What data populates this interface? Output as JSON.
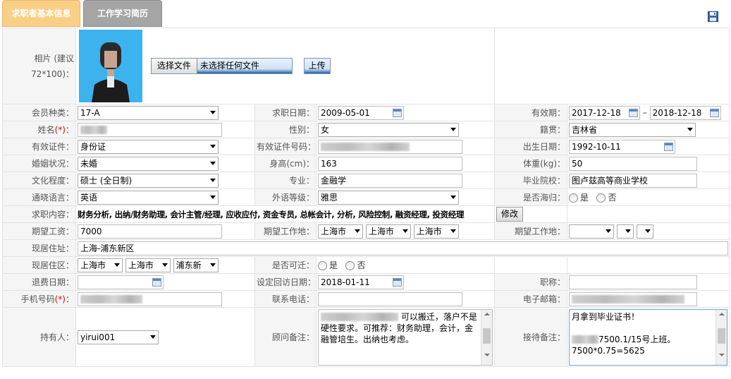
{
  "tabs": [
    {
      "label": "求职者基本信息",
      "active": true
    },
    {
      "label": "工作学习简历",
      "active": false
    }
  ],
  "photo": {
    "label": "相片 (建议72*100)：",
    "choose_file": "选择文件",
    "no_file": "未选择任何文件",
    "upload": "上传"
  },
  "fields": {
    "member_type": {
      "label": "会员种类：",
      "value": "17-A"
    },
    "apply_date": {
      "label": "求职日期：",
      "value": "2009-05-01"
    },
    "valid_period": {
      "label": "有效期：",
      "from": "2017-12-18",
      "sep": "–",
      "to": "2018-12-18"
    },
    "name": {
      "label": "姓名",
      "required_mark": "(*)",
      "colon": "："
    },
    "gender": {
      "label": "性别：",
      "value": "女"
    },
    "native_place": {
      "label": "籍贯：",
      "value": "吉林省"
    },
    "id_type": {
      "label": "有效证件：",
      "value": "身份证"
    },
    "id_number": {
      "label": "有效证件号码："
    },
    "birth_date": {
      "label": "出生日期：",
      "value": "1992-10-11"
    },
    "marital": {
      "label": "婚姻状况：",
      "value": "未婚"
    },
    "height": {
      "label": "身高(cm)：",
      "value": "163"
    },
    "weight": {
      "label": "体重(kg)：",
      "value": "50"
    },
    "education": {
      "label": "文化程度：",
      "value": "硕士 (全日制)"
    },
    "major": {
      "label": "专业：",
      "value": "金融学"
    },
    "school": {
      "label": "毕业院校：",
      "value": "图卢兹高等商业学校"
    },
    "language": {
      "label": "通晓语言：",
      "value": "英语"
    },
    "foreign_level": {
      "label": "外语等级：",
      "value": "雅思"
    },
    "returnee": {
      "label": "是否海归：",
      "yes": "是",
      "no": "否"
    },
    "job_content": {
      "label": "求职内容：",
      "value": "财务分析, 出纳/财务助理, 会计主管/经理, 应收应付, 资金专员, 总帐会计, 分析, 风险控制, 融资经理, 投资经理",
      "edit": "修改"
    },
    "expected_salary": {
      "label": "期望工资：",
      "value": "7000"
    },
    "expected_location": {
      "label": "期望工作地：",
      "v1": "上海市",
      "v2": "上海市",
      "v3": "上海市"
    },
    "expected_location2": {
      "label": "期望工作地："
    },
    "current_address": {
      "label": "现居住址：",
      "value": "上海-浦东新区"
    },
    "current_district": {
      "label": "现居住区：",
      "v1": "上海市",
      "v2": "上海市",
      "v3": "浦东新"
    },
    "relocate": {
      "label": "是否可迁：",
      "yes": "是",
      "no": "否"
    },
    "refund_date": {
      "label": "退费日期："
    },
    "callback_date": {
      "label": "设定回访日期：",
      "value": "2018-01-11"
    },
    "title": {
      "label": "职称："
    },
    "mobile": {
      "label": "手机号码",
      "required_mark": "(*)",
      "colon": "："
    },
    "phone": {
      "label": "联系电话："
    },
    "email": {
      "label": "电子邮箱："
    },
    "holder": {
      "label": "持有人：",
      "value": "yirui001"
    },
    "advisor_note": {
      "label": "顾问备注：",
      "text": "可以搬迁，落户不是硬性要求。可推荐：财务助理，会计，金融管培生。出纳也考虑。"
    },
    "reception_note": {
      "label": "接待备注：",
      "line1": "月拿到毕业证书！",
      "line2": "7500.1/15号上班。",
      "line3": "7500*0.75=5625"
    }
  }
}
